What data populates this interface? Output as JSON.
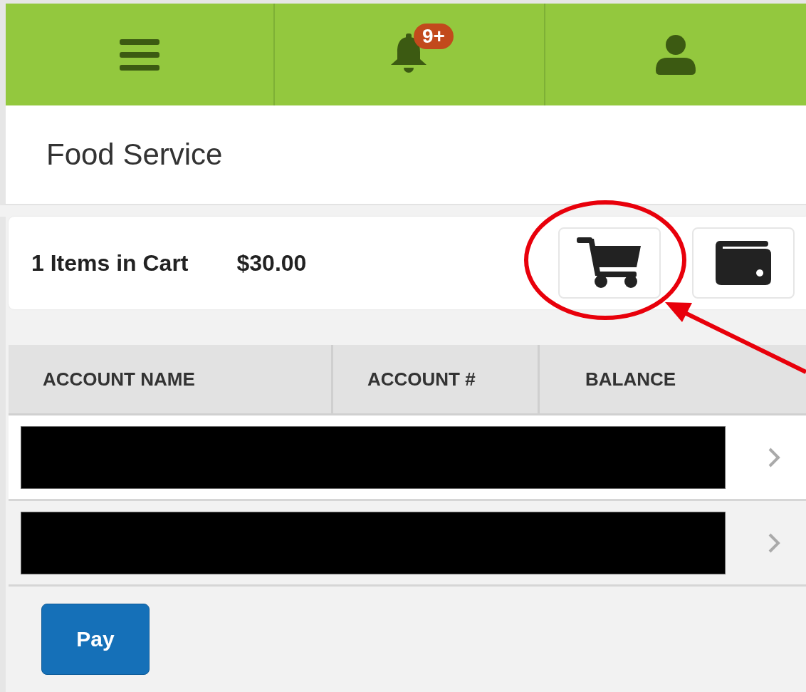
{
  "nav": {
    "notification_badge": "9+"
  },
  "page_title": "Food Service",
  "cart": {
    "items_label": "1 Items in Cart",
    "total": "$30.00"
  },
  "table": {
    "columns": [
      "ACCOUNT NAME",
      "ACCOUNT #",
      "BALANCE"
    ],
    "rows": [
      {
        "redacted": true
      },
      {
        "redacted": true
      }
    ]
  },
  "buttons": [
    "Pay"
  ]
}
